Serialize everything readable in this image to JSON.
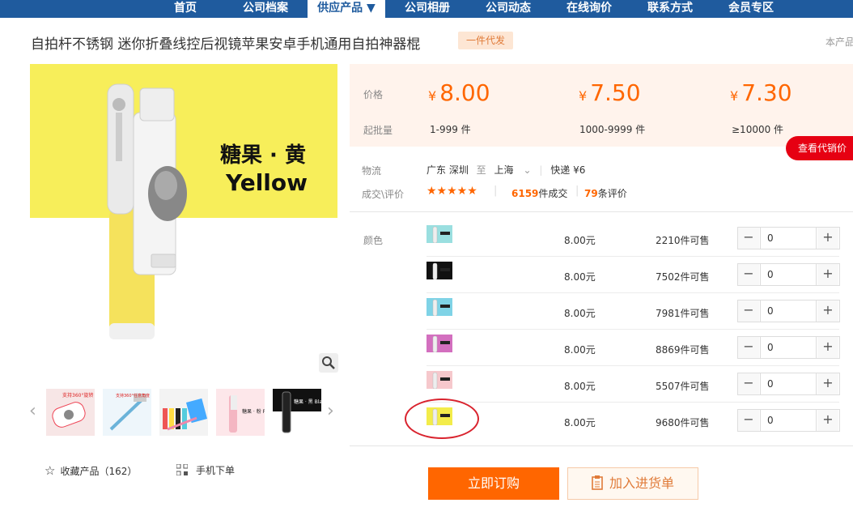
{
  "nav": {
    "items": [
      "首页",
      "公司档案",
      "供应产品 ▼",
      "公司相册",
      "公司动态",
      "在线询价",
      "联系方式",
      "会员专区"
    ],
    "active_index": 2,
    "color": "#1f5b9e"
  },
  "product": {
    "title": "自拍杆不锈钢 迷你折叠线控后视镜苹果安卓手机通用自拍神器棍",
    "badge": "一件代发",
    "right_note": "本产品",
    "image_text_cn": "糖果 · 黄",
    "image_text_en": "Yellow"
  },
  "thumbs": {
    "items": [
      {
        "caption": "支持360°旋转",
        "icon": "thumb-white-stick"
      },
      {
        "caption": "支持360°任意角度",
        "icon": "thumb-blue-stick"
      },
      {
        "caption": "",
        "icon": "thumb-color-sticks"
      },
      {
        "caption": "糖果 · 粉 Pink",
        "icon": "thumb-pink-stick"
      },
      {
        "caption": "糖果 · 黑 Black",
        "icon": "thumb-black-stick"
      }
    ],
    "prev_icon": "‹",
    "next_icon": "›"
  },
  "actions": {
    "favorite_label": "收藏产品（162）",
    "mobile_label": "手机下单",
    "buy_label": "立即订购",
    "cart_label": "加入进货单"
  },
  "pricing": {
    "price_label": "价格",
    "moq_label": "起批量",
    "currency": "¥",
    "tiers": [
      {
        "price": "8.00",
        "moq": "1-999 件"
      },
      {
        "price": "7.50",
        "moq": "1000-9999 件"
      },
      {
        "price": "7.30",
        "moq": "≥10000 件"
      }
    ],
    "agent_button": "查看代销价"
  },
  "logistics": {
    "label": "物流",
    "from": "广东 深圳",
    "to_word": "至",
    "to": "上海",
    "method": "快递 ¥6"
  },
  "reviews": {
    "label": "成交\\评价",
    "stars": "★★★★★",
    "deals_count": "6159",
    "deals_suffix": "件成交",
    "reviews_count": "79",
    "reviews_suffix": "条评价"
  },
  "sku": {
    "color_label": "颜色",
    "rows": [
      {
        "color": "#9adfe0",
        "price": "8.00元",
        "stock": "2210件可售",
        "qty": "0"
      },
      {
        "color": "#111111",
        "price": "8.00元",
        "stock": "7502件可售",
        "qty": "0"
      },
      {
        "color": "#7fd3e6",
        "price": "8.00元",
        "stock": "7981件可售",
        "qty": "0"
      },
      {
        "color": "#d36fbf",
        "price": "8.00元",
        "stock": "8869件可售",
        "qty": "0"
      },
      {
        "color": "#f6c8cc",
        "price": "8.00元",
        "stock": "5507件可售",
        "qty": "0"
      },
      {
        "color": "#f3ec4a",
        "price": "8.00元",
        "stock": "9680件可售",
        "qty": "0"
      }
    ],
    "minus": "−",
    "plus": "+"
  },
  "colors": {
    "accent": "#ff6600",
    "red": "#e60012",
    "nav": "#1f5b9e"
  }
}
